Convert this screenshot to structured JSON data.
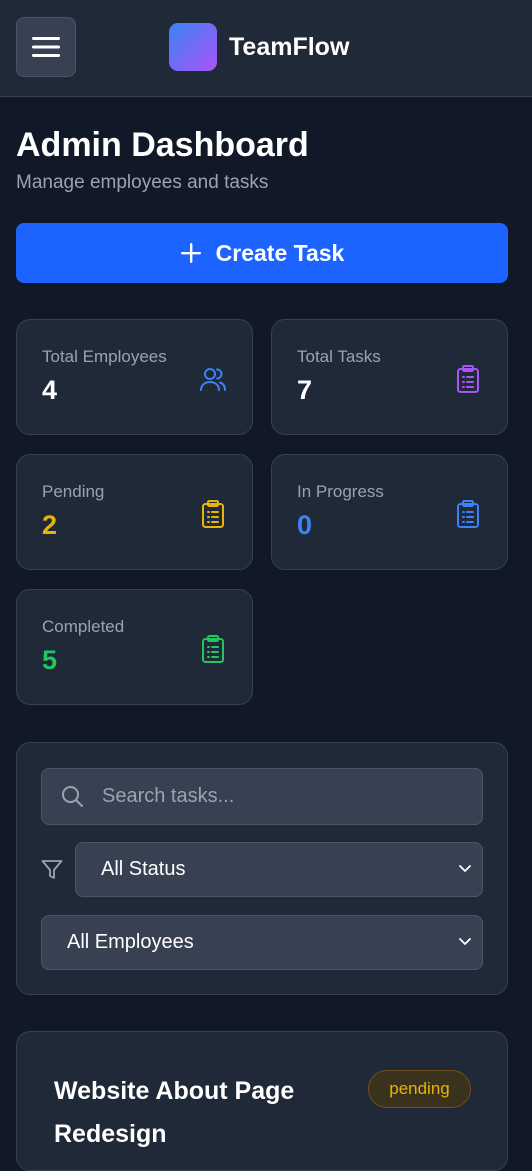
{
  "header": {
    "brand": "TeamFlow",
    "icons": {
      "menu": "menu-icon",
      "logo": "gradient-logo"
    }
  },
  "page": {
    "title": "Admin Dashboard",
    "subtitle": "Manage employees and tasks"
  },
  "actions": {
    "create_task": "Create Task",
    "create_icon": "plus-icon"
  },
  "stats": [
    {
      "label": "Total Employees",
      "value": "4",
      "color": "#ffffff",
      "icon": "users-icon",
      "icon_color": "#3b82f6"
    },
    {
      "label": "Total Tasks",
      "value": "7",
      "color": "#ffffff",
      "icon": "clipboard-icon",
      "icon_color": "#a855f7"
    },
    {
      "label": "Pending",
      "value": "2",
      "color": "#eab308",
      "icon": "clipboard-icon",
      "icon_color": "#eab308"
    },
    {
      "label": "In Progress",
      "value": "0",
      "color": "#3b82f6",
      "icon": "clipboard-icon",
      "icon_color": "#3b82f6"
    },
    {
      "label": "Completed",
      "value": "5",
      "color": "#22c55e",
      "icon": "clipboard-icon",
      "icon_color": "#22c55e"
    }
  ],
  "filters": {
    "search_placeholder": "Search tasks...",
    "status_selected": "All Status",
    "employee_selected": "All Employees"
  },
  "tasks": [
    {
      "title": "Website About Page Redesign",
      "status": "pending"
    }
  ],
  "colors": {
    "accent": "#1d63ff",
    "background": "#111827",
    "card": "#1f2937"
  }
}
